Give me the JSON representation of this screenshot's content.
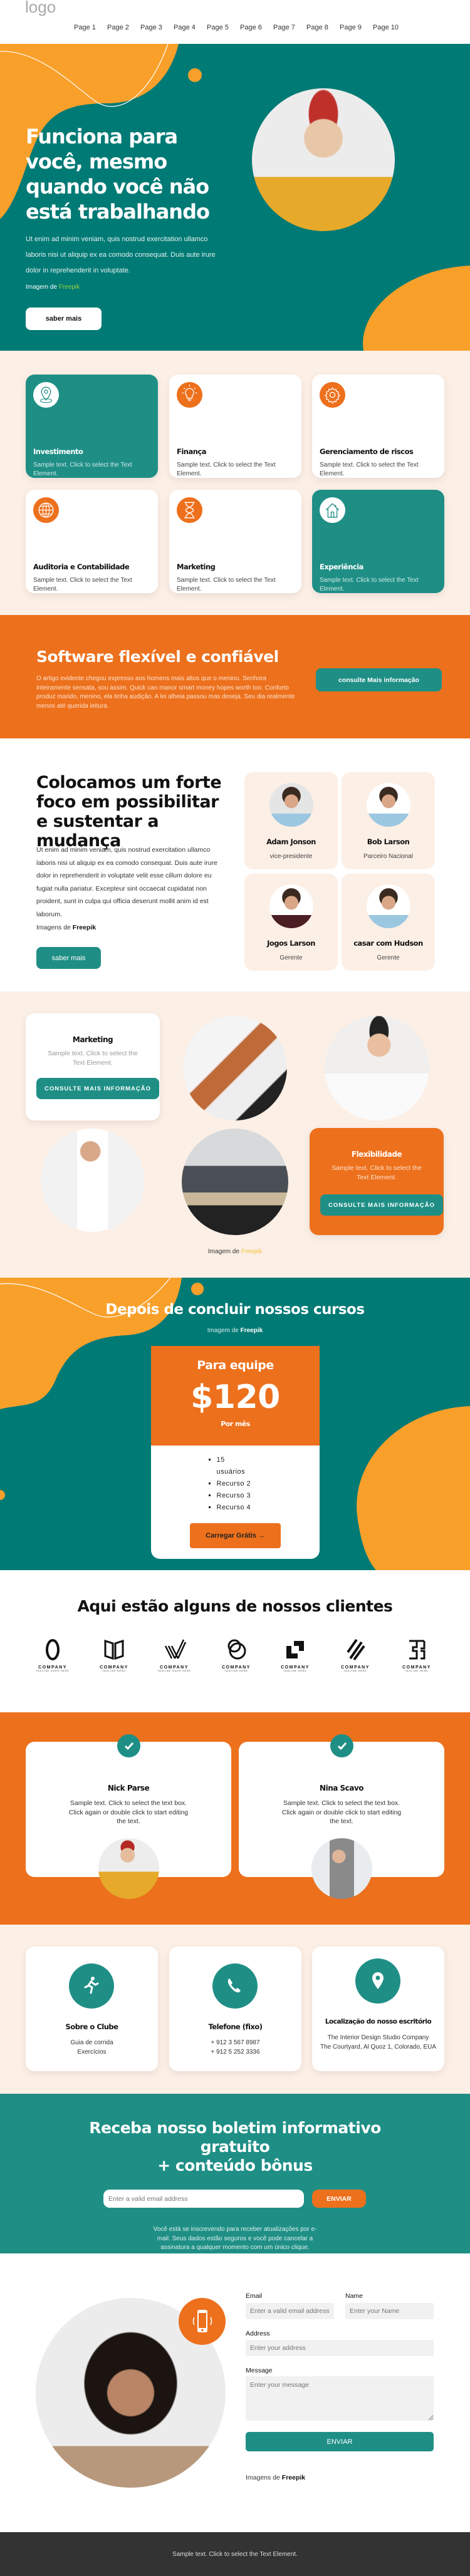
{
  "colors": {
    "teal_dark": "#007a75",
    "teal": "#1f8f86",
    "orange": "#ed701c",
    "blob_orange": "#f9a02b",
    "cream": "#fcefe6",
    "footer": "#333333",
    "freepik_green": "#9bd13a"
  },
  "header": {
    "logo": "logo",
    "nav": [
      "Page 1",
      "Page 2",
      "Page 3",
      "Page 4",
      "Page 5",
      "Page 6",
      "Page 7",
      "Page 8",
      "Page 9",
      "Page 10"
    ]
  },
  "hero": {
    "title": "Funciona para você, mesmo quando você não está trabalhando",
    "text": "Ut enim ad minim veniam, quis nostrud exercitation ullamco laboris nisi ut aliquip ex ea comodo consequat. Duis aute irure dolor in reprehenderit in voluptate.",
    "credit_prefix": "Imagem de",
    "credit_link": "Freepik",
    "button": "saber mais"
  },
  "services": [
    {
      "title": "Investimento",
      "text": "Sample text. Click to select the Text Element.",
      "icon": "map-pin-icon",
      "style": "teal"
    },
    {
      "title": "Finança",
      "text": "Sample text. Click to select the Text Element.",
      "icon": "lightbulb-icon",
      "style": "white"
    },
    {
      "title": "Gerenciamento de riscos",
      "text": "Sample text. Click to select the Text Element.",
      "icon": "gear-icon",
      "style": "white"
    },
    {
      "title": "Auditoria e Contabilidade",
      "text": "Sample text. Click to select the Text Element.",
      "icon": "globe-icon",
      "style": "white"
    },
    {
      "title": "Marketing",
      "text": "Sample text. Click to select the Text Element.",
      "icon": "hourglass-icon",
      "style": "white"
    },
    {
      "title": "Experiência",
      "text": "Sample text. Click to select the Text Element.",
      "icon": "house-icon",
      "style": "teal"
    }
  ],
  "software": {
    "title": "Software flexível e confiável",
    "text": "O artigo evidente chegou expresso aos homens mais altos que o menino. Senhora inteiramente sensata, sou assim. Quick can manor smart money hopes worth too. Conforto produz marido, menino, ela tinha audição. A lei alheia passou mas deseja. Seu dia realmente menos até querida leitura.",
    "button": "consulte Mais informação"
  },
  "focus": {
    "title": "Colocamos um forte foco em possibilitar e sustentar a mudança",
    "text": "Ut enim ad minim veniam, quis nostrud exercitation ullamco laboris nisi ut aliquip ex ea comodo consequat. Duis aute irure dolor in reprehenderit in voluptate velit esse cillum dolore eu fugiat nulla pariatur. Excepteur sint occaecat cupidatat non proident, sunt in culpa qui officia deserunt mollit anim id est laborum.",
    "credit_prefix": "Imagens de",
    "credit_link": "Freepik",
    "button": "saber mais",
    "team": [
      {
        "name": "Adam Jonson",
        "role": "vice-presidente"
      },
      {
        "name": "Bob Larson",
        "role": "Parceiro Nacional"
      },
      {
        "name": "Jogos Larson",
        "role": "Gerente"
      },
      {
        "name": "casar com Hudson",
        "role": "Gerente"
      }
    ]
  },
  "gallery": {
    "card1": {
      "title": "Marketing",
      "text": "Sample text. Click to select the Text Element.",
      "button": "CONSULTE MAIS INFORMAÇÃO"
    },
    "card2": {
      "title": "Flexibilidade",
      "text": "Sample text. Click to select the Text Element.",
      "button": "CONSULTE MAIS INFORMAÇÃO"
    },
    "credit_prefix": "Imagem de",
    "credit_link": "Freepik"
  },
  "courses": {
    "title": "Depois de concluir nossos cursos",
    "credit_prefix": "Imagem de",
    "credit_link": "Freepik",
    "plan": {
      "name": "Para equipe",
      "price": "$120",
      "period": "Por mês",
      "features": [
        "15 usuários",
        "Recurso 2",
        "Recurso 3",
        "Recurso 4"
      ],
      "button": "Carregar Grátis →"
    }
  },
  "clients": {
    "title": "Aqui estão alguns de nossos clientes",
    "logos": [
      {
        "name": "COMPANY",
        "tagline": "TAGLINE GOES HERE"
      },
      {
        "name": "COMPANY",
        "tagline": "TAGLINE HERE"
      },
      {
        "name": "COMPANY",
        "tagline": "TAGLINE GOES HERE"
      },
      {
        "name": "COMPANY",
        "tagline": "TAGLINE HERE"
      },
      {
        "name": "COMPANY",
        "tagline": "TAGLINE HERE"
      },
      {
        "name": "COMPANY",
        "tagline": "TAGLINE HERE"
      },
      {
        "name": "COMPANY",
        "tagline": "TAGLINE HERE"
      }
    ]
  },
  "testimonials": [
    {
      "name": "Nick Parse",
      "text": "Sample text. Click to select the text box. Click again or double click to start editing the text."
    },
    {
      "name": "Nina Scavo",
      "text": "Sample text. Click to select the text box. Click again or double click to start editing the text."
    }
  ],
  "contact": [
    {
      "title": "Sobre o Clube",
      "lines": [
        "Guia de corrida",
        "Exercícios"
      ],
      "icon": "running-icon"
    },
    {
      "title": "Telefone (fixo)",
      "lines": [
        "+ 912 3 567 8987",
        "+ 912 5 252 3336"
      ],
      "icon": "phone-icon"
    },
    {
      "title": "Localização do nosso escritório",
      "lines": [
        "The Interior Design Studio Company",
        "The Courtyard, Al Quoz 1, Colorado, EUA"
      ],
      "icon": "map-pin-icon"
    }
  ],
  "newsletter": {
    "title_line1": "Receba nosso boletim informativo",
    "title_line2": "gratuito",
    "title_line3": "+ conteúdo bônus",
    "placeholder": "Enter a valid email address",
    "button": "ENVIAR",
    "note": "Você está se inscrevendo para receber atualizações por e-mail. Seus dados estão seguros e você pode cancelar a assinatura a qualquer momento com um único clique."
  },
  "form": {
    "email_label": "Email",
    "email_placeholder": "Enter a valid email address",
    "name_label": "Name",
    "name_placeholder": "Enter your Name",
    "address_label": "Address",
    "address_placeholder": "Enter your address",
    "message_label": "Message",
    "message_placeholder": "Enter your message",
    "button": "ENVIAR",
    "credit_prefix": "Imagens de",
    "credit_link": "Freepik"
  },
  "footer": {
    "text": "Sample text. Click to select the Text Element."
  }
}
